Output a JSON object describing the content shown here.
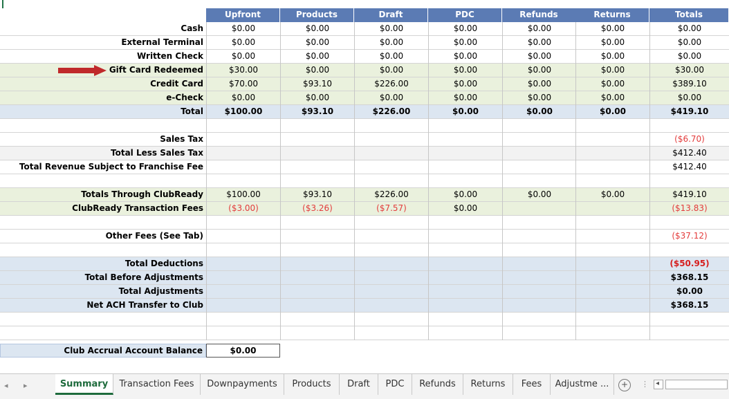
{
  "columns": [
    "Upfront",
    "Products",
    "Draft",
    "PDC",
    "Refunds",
    "Returns",
    "Totals"
  ],
  "rows": [
    {
      "label": "Cash",
      "values": [
        "$0.00",
        "$0.00",
        "$0.00",
        "$0.00",
        "$0.00",
        "$0.00",
        "$0.00"
      ],
      "style": "plain"
    },
    {
      "label": "External Terminal",
      "values": [
        "$0.00",
        "$0.00",
        "$0.00",
        "$0.00",
        "$0.00",
        "$0.00",
        "$0.00"
      ],
      "style": "plain"
    },
    {
      "label": "Written Check",
      "values": [
        "$0.00",
        "$0.00",
        "$0.00",
        "$0.00",
        "$0.00",
        "$0.00",
        "$0.00"
      ],
      "style": "plain"
    },
    {
      "label": "Gift Card Redeemed",
      "values": [
        "$30.00",
        "$0.00",
        "$0.00",
        "$0.00",
        "$0.00",
        "$0.00",
        "$30.00"
      ],
      "style": "green"
    },
    {
      "label": "Credit Card",
      "values": [
        "$70.00",
        "$93.10",
        "$226.00",
        "$0.00",
        "$0.00",
        "$0.00",
        "$389.10"
      ],
      "style": "green"
    },
    {
      "label": "e-Check",
      "values": [
        "$0.00",
        "$0.00",
        "$0.00",
        "$0.00",
        "$0.00",
        "$0.00",
        "$0.00"
      ],
      "style": "green"
    },
    {
      "label": "Total",
      "values": [
        "$100.00",
        "$93.10",
        "$226.00",
        "$0.00",
        "$0.00",
        "$0.00",
        "$419.10"
      ],
      "style": "blue-bold"
    },
    {
      "label": "",
      "values": [
        "",
        "",
        "",
        "",
        "",
        "",
        ""
      ],
      "style": "plain"
    },
    {
      "label": "Sales Tax",
      "values": [
        "",
        "",
        "",
        "",
        "",
        "",
        "($6.70)"
      ],
      "style": "plain"
    },
    {
      "label": "Total Less Sales Tax",
      "values": [
        "",
        "",
        "",
        "",
        "",
        "",
        "$412.40"
      ],
      "style": "gray"
    },
    {
      "label": "Total Revenue Subject to Franchise Fee",
      "values": [
        "",
        "",
        "",
        "",
        "",
        "",
        "$412.40"
      ],
      "style": "plain"
    },
    {
      "label": "",
      "values": [
        "",
        "",
        "",
        "",
        "",
        "",
        ""
      ],
      "style": "plain"
    },
    {
      "label": "Totals Through ClubReady",
      "values": [
        "$100.00",
        "$93.10",
        "$226.00",
        "$0.00",
        "$0.00",
        "$0.00",
        "$419.10"
      ],
      "style": "green"
    },
    {
      "label": "ClubReady Transaction Fees",
      "values": [
        "($3.00)",
        "($3.26)",
        "($7.57)",
        "$0.00",
        "",
        "",
        "($13.83)"
      ],
      "style": "green"
    },
    {
      "label": "",
      "values": [
        "",
        "",
        "",
        "",
        "",
        "",
        ""
      ],
      "style": "plain"
    },
    {
      "label": "Other Fees (See Tab)",
      "values": [
        "",
        "",
        "",
        "",
        "",
        "",
        "($37.12)"
      ],
      "style": "plain"
    },
    {
      "label": "",
      "values": [
        "",
        "",
        "",
        "",
        "",
        "",
        ""
      ],
      "style": "plain"
    },
    {
      "label": "Total Deductions",
      "values": [
        "",
        "",
        "",
        "",
        "",
        "",
        "($50.95)"
      ],
      "style": "blue"
    },
    {
      "label": "Total Before Adjustments",
      "values": [
        "",
        "",
        "",
        "",
        "",
        "",
        "$368.15"
      ],
      "style": "blue"
    },
    {
      "label": "Total Adjustments",
      "values": [
        "",
        "",
        "",
        "",
        "",
        "",
        "$0.00"
      ],
      "style": "blue"
    },
    {
      "label": "Net ACH Transfer to Club",
      "values": [
        "",
        "",
        "",
        "",
        "",
        "",
        "$368.15"
      ],
      "style": "blue"
    },
    {
      "label": "",
      "values": [
        "",
        "",
        "",
        "",
        "",
        "",
        ""
      ],
      "style": "plain"
    },
    {
      "label": "",
      "values": [
        "",
        "",
        "",
        "",
        "",
        "",
        ""
      ],
      "style": "plain"
    }
  ],
  "accrual": {
    "label": "Club Accrual Account Balance",
    "value": "$0.00"
  },
  "tabs": [
    "Summary",
    "Transaction Fees",
    "Downpayments",
    "Products",
    "Draft",
    "PDC",
    "Refunds",
    "Returns",
    "Fees",
    "Adjustme ..."
  ],
  "active_tab": "Summary",
  "colors": {
    "header": "#5b7bb4",
    "green": "#eaf1dd",
    "blue": "#dce6f1",
    "gray": "#f2f2f2",
    "negative": "#e33b3b",
    "arrow": "#c0292b",
    "active_tab": "#1e6b3c"
  }
}
